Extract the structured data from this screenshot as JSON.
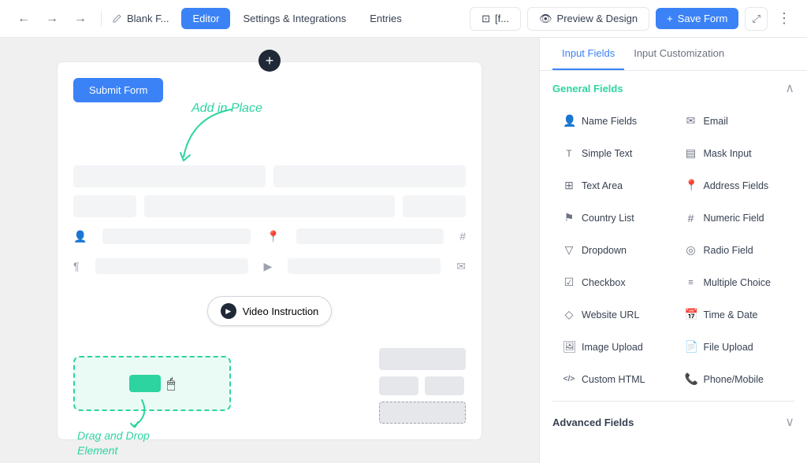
{
  "nav": {
    "back_label": "←",
    "forward_label": "→",
    "redo_label": "→",
    "title": "Blank F...",
    "tabs": [
      {
        "id": "editor",
        "label": "Editor",
        "active": true
      },
      {
        "id": "settings",
        "label": "Settings & Integrations",
        "active": false
      },
      {
        "id": "entries",
        "label": "Entries",
        "active": false
      }
    ],
    "preview_label": "Preview & Design",
    "save_label": "Save Form",
    "form_ref": "[f..."
  },
  "panel": {
    "tabs": [
      {
        "id": "input-fields",
        "label": "Input Fields",
        "active": true
      },
      {
        "id": "input-customization",
        "label": "Input Customization",
        "active": false
      }
    ],
    "general_fields_title": "General Fields",
    "fields": [
      {
        "id": "name-fields",
        "label": "Name Fields",
        "icon": "👤"
      },
      {
        "id": "email",
        "label": "Email",
        "icon": "✉"
      },
      {
        "id": "simple-text",
        "label": "Simple Text",
        "icon": "Ƭ"
      },
      {
        "id": "mask-input",
        "label": "Mask Input",
        "icon": "⊡"
      },
      {
        "id": "text-area",
        "label": "Text Area",
        "icon": "⊞"
      },
      {
        "id": "address-fields",
        "label": "Address Fields",
        "icon": "📍"
      },
      {
        "id": "country-list",
        "label": "Country List",
        "icon": "⚑"
      },
      {
        "id": "numeric-field",
        "label": "Numeric Field",
        "icon": "#"
      },
      {
        "id": "dropdown",
        "label": "Dropdown",
        "icon": "⊡"
      },
      {
        "id": "radio-field",
        "label": "Radio Field",
        "icon": "◎"
      },
      {
        "id": "checkbox",
        "label": "Checkbox",
        "icon": "☑"
      },
      {
        "id": "multiple-choice",
        "label": "Multiple Choice",
        "icon": "≡"
      },
      {
        "id": "website-url",
        "label": "Website URL",
        "icon": "◇"
      },
      {
        "id": "time-date",
        "label": "Time & Date",
        "icon": "📅"
      },
      {
        "id": "image-upload",
        "label": "Image Upload",
        "icon": "🖼"
      },
      {
        "id": "file-upload",
        "label": "File Upload",
        "icon": "📄"
      },
      {
        "id": "custom-html",
        "label": "Custom HTML",
        "icon": "</>"
      },
      {
        "id": "phone-mobile",
        "label": "Phone/Mobile",
        "icon": "📞"
      }
    ],
    "advanced_fields_title": "Advanced Fields"
  },
  "canvas": {
    "submit_label": "Submit Form",
    "add_in_place": "Add in Place",
    "video_instruction": "Video Instruction",
    "drag_drop_label": "Drag and Drop\nElement",
    "accent_color": "#2dd4a0"
  }
}
